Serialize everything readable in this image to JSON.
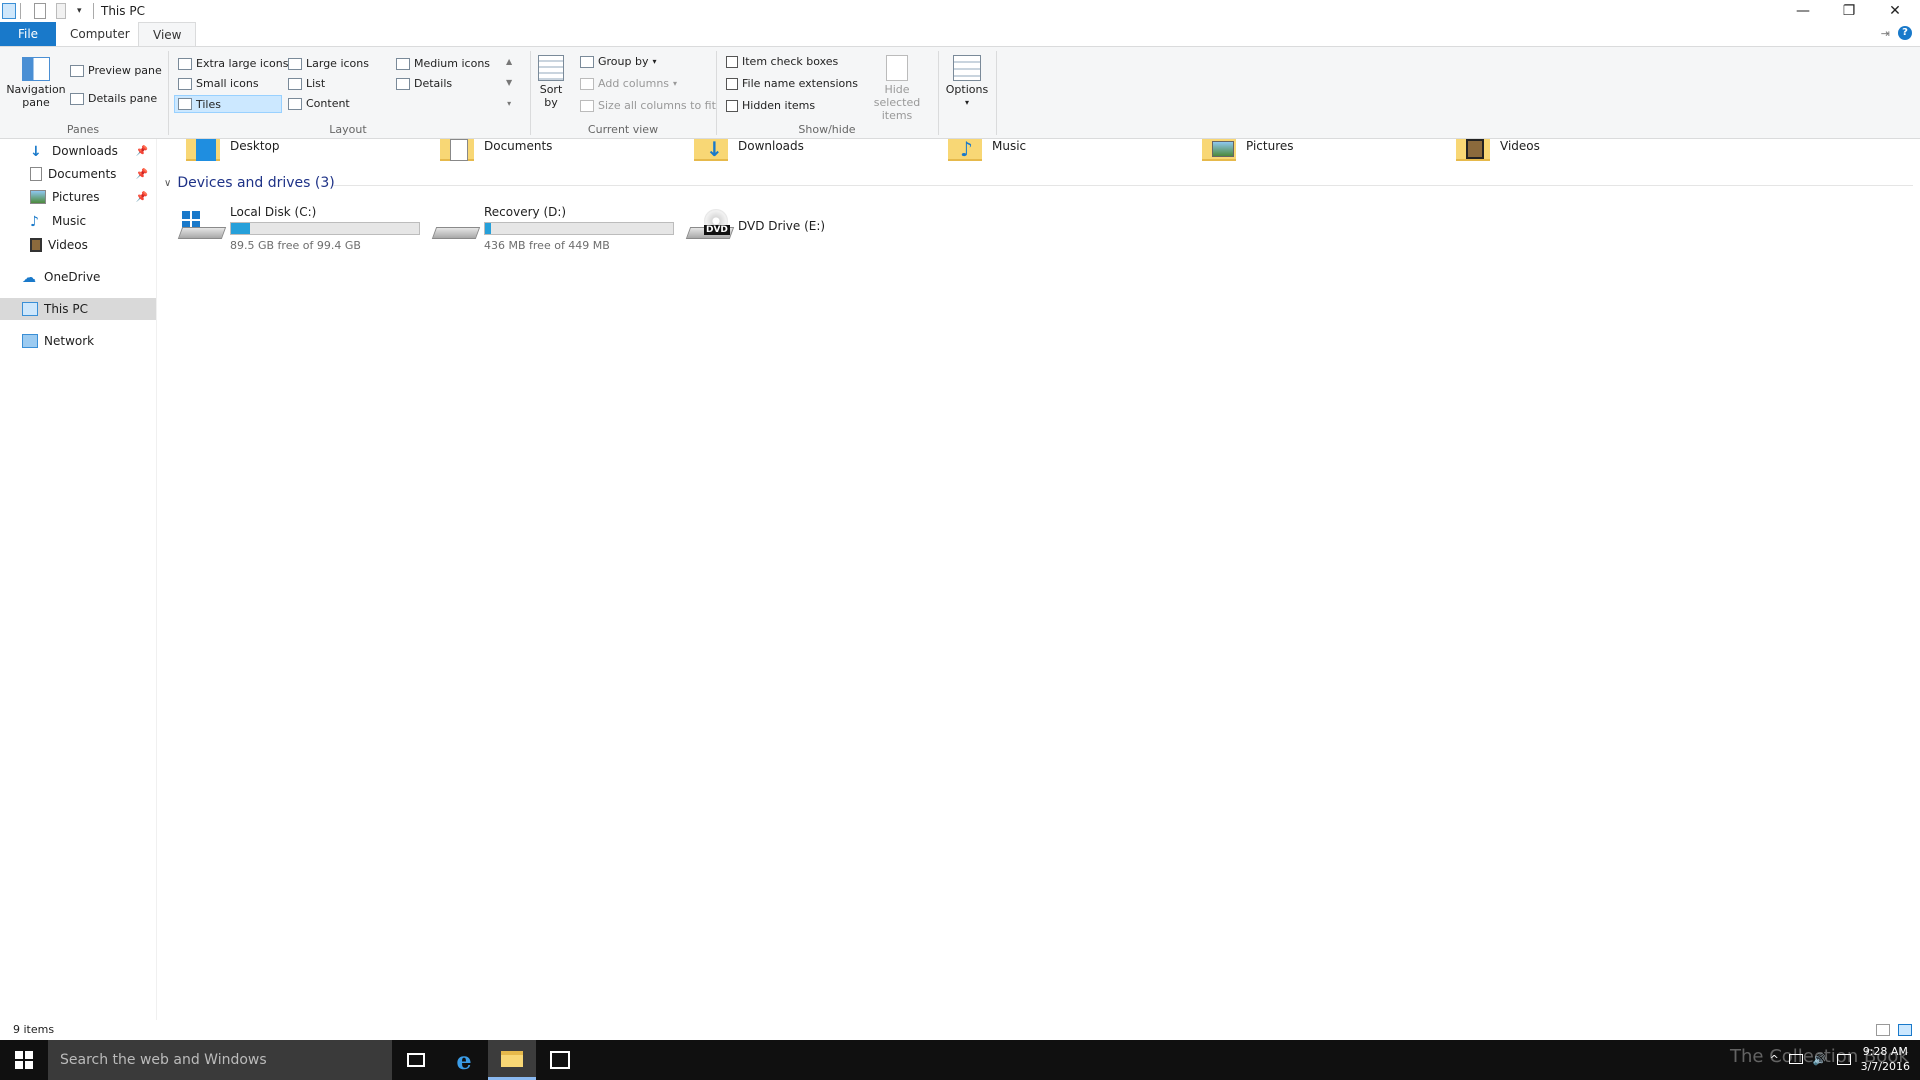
{
  "window": {
    "title": "This PC",
    "controls": {
      "minimize": "—",
      "restore": "❐",
      "close": "✕"
    }
  },
  "tabs": {
    "file": "File",
    "computer": "Computer",
    "view": "View"
  },
  "ribbon": {
    "panes": {
      "navigation_pane": "Navigation pane",
      "preview_pane": "Preview pane",
      "details_pane": "Details pane",
      "label": "Panes"
    },
    "layout": {
      "extra_large_icons": "Extra large icons",
      "large_icons": "Large icons",
      "medium_icons": "Medium icons",
      "small_icons": "Small icons",
      "list": "List",
      "details": "Details",
      "tiles": "Tiles",
      "content": "Content",
      "label": "Layout"
    },
    "current_view": {
      "sort_by": "Sort by",
      "group_by": "Group by",
      "add_columns": "Add columns",
      "size_all_columns": "Size all columns to fit",
      "label": "Current view"
    },
    "show_hide": {
      "item_check_boxes": "Item check boxes",
      "file_name_extensions": "File name extensions",
      "hidden_items": "Hidden items",
      "hide_selected_items": "Hide selected items",
      "label": "Show/hide"
    },
    "options": "Options"
  },
  "nav": {
    "items": [
      {
        "label": "Downloads",
        "pinned": true,
        "icon": "download-arrow-icon"
      },
      {
        "label": "Documents",
        "pinned": true,
        "icon": "document-icon"
      },
      {
        "label": "Pictures",
        "pinned": true,
        "icon": "pictures-icon"
      },
      {
        "label": "Music",
        "pinned": false,
        "icon": "music-note-icon"
      },
      {
        "label": "Videos",
        "pinned": false,
        "icon": "film-icon"
      },
      {
        "label": "OneDrive",
        "icon": "cloud-icon"
      },
      {
        "label": "This PC",
        "icon": "computer-icon",
        "selected": true
      },
      {
        "label": "Network",
        "icon": "network-icon"
      }
    ]
  },
  "folders": [
    "Desktop",
    "Documents",
    "Downloads",
    "Music",
    "Pictures",
    "Videos"
  ],
  "devices_section": "Devices and drives (3)",
  "drives": [
    {
      "name": "Local Disk (C:)",
      "free": "89.5 GB free of 99.4 GB",
      "used_fraction": 0.1
    },
    {
      "name": "Recovery (D:)",
      "free": "436 MB free of 449 MB",
      "used_fraction": 0.03
    },
    {
      "name": "DVD Drive (E:)",
      "badge": "DVD"
    }
  ],
  "status": "9 items",
  "taskbar": {
    "search_placeholder": "Search the web and Windows",
    "time": "9:28 AM",
    "date": "3/7/2016",
    "watermark": "The Collection Book"
  },
  "colors": {
    "accent": "#1979ca",
    "drive_fill": "#26a0da",
    "folder": "#f8d775"
  }
}
